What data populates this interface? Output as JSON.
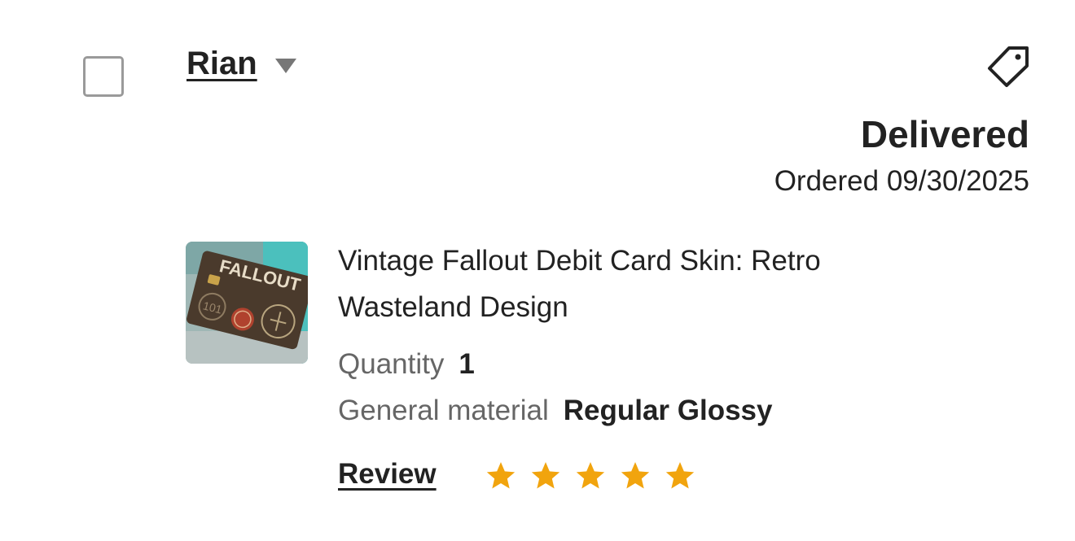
{
  "order": {
    "buyer_name": "Rian",
    "status": "Delivered",
    "ordered_label": "Ordered 09/30/2025"
  },
  "item": {
    "title": "Vintage Fallout Debit Card Skin: Retro Wasteland Design",
    "thumbnail_text": "FALLOUT",
    "thumbnail_badge": "101",
    "quantity_label": "Quantity",
    "quantity_value": "1",
    "material_label": "General material",
    "material_value": "Regular Glossy"
  },
  "review": {
    "label": "Review",
    "rating": 5,
    "max_rating": 5
  },
  "colors": {
    "star": "#F1A40E",
    "text": "#222222",
    "muted": "#666666",
    "checkbox_border": "#9A9A9A"
  },
  "icons": {
    "tag": "tag-icon",
    "caret": "caret-down-icon",
    "star": "star-icon"
  }
}
